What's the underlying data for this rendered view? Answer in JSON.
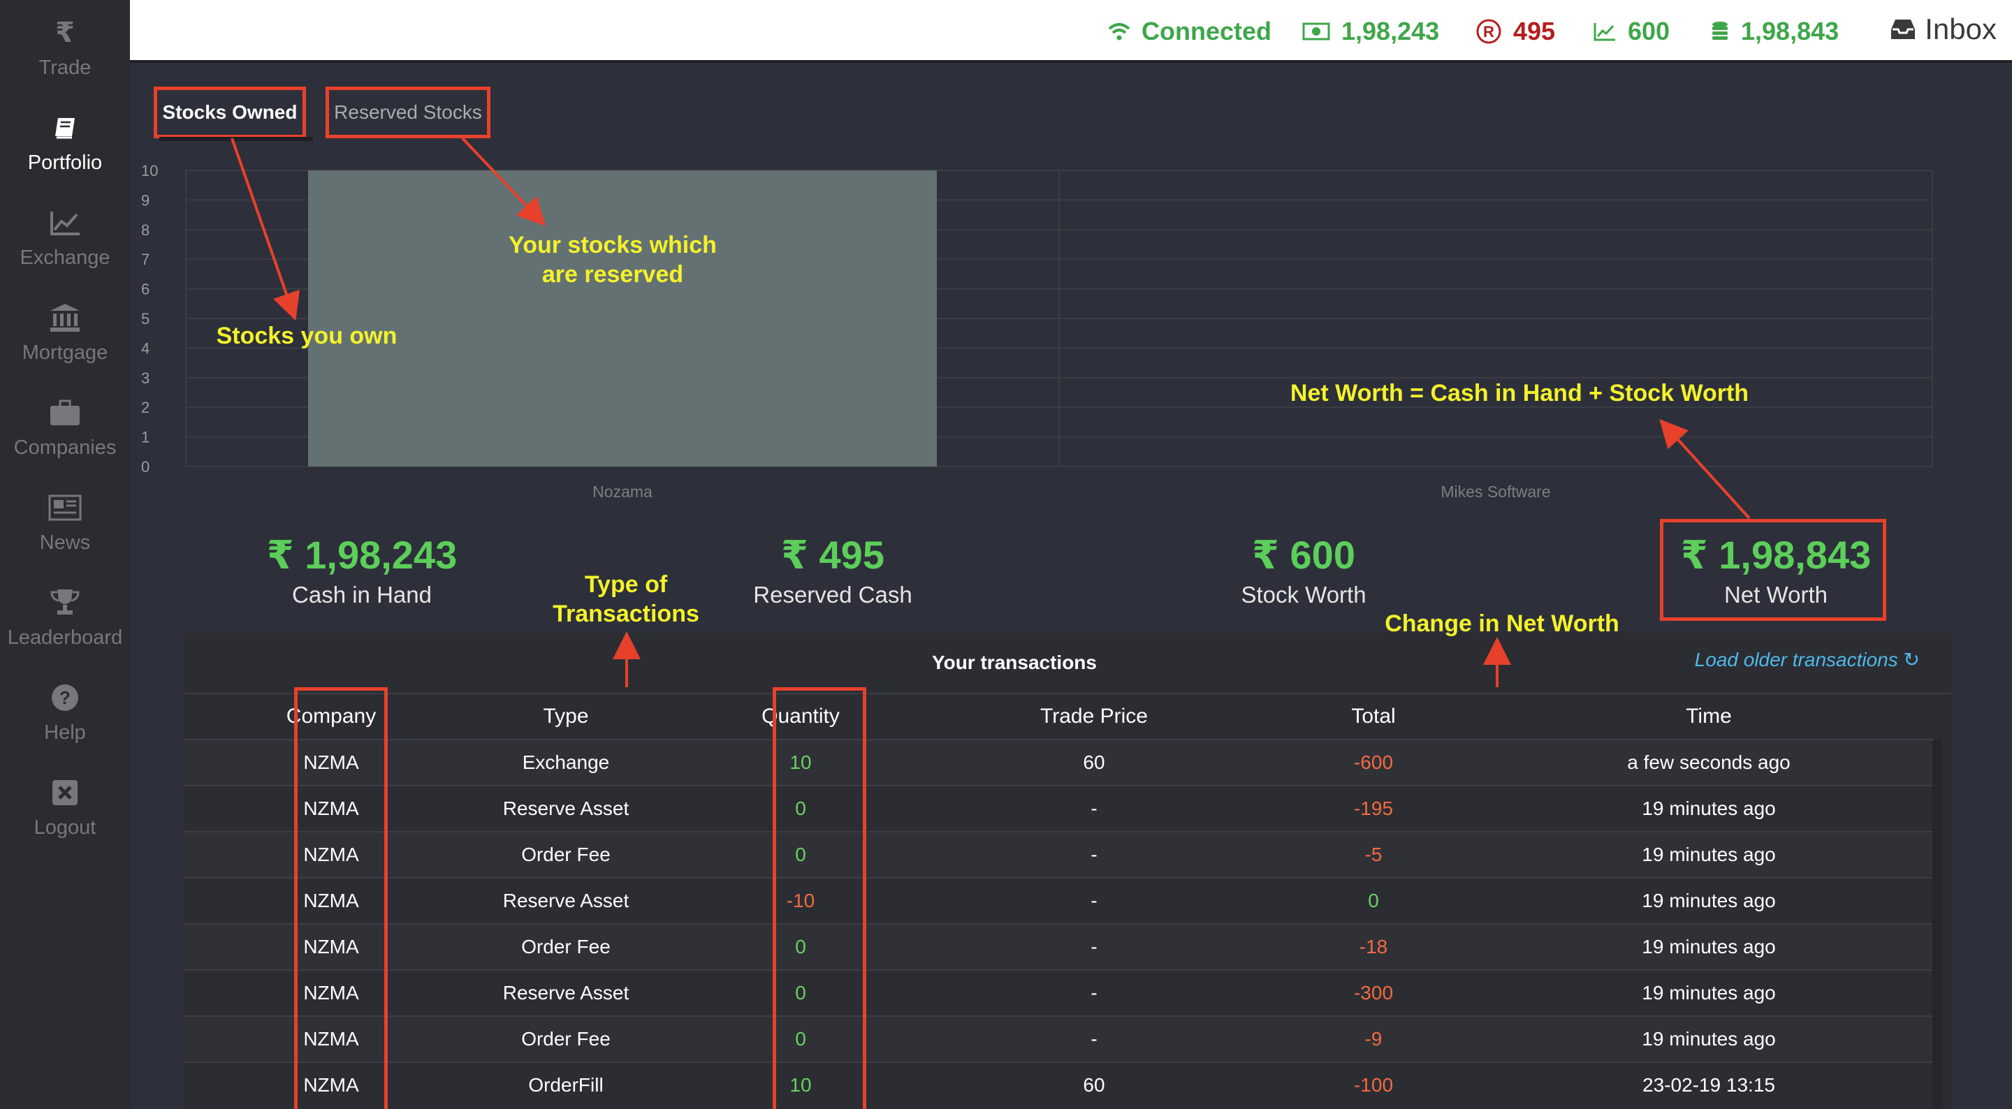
{
  "sidebar": {
    "items": [
      {
        "label": "Trade",
        "icon": "rupee-icon",
        "active": false
      },
      {
        "label": "Portfolio",
        "icon": "book-icon",
        "active": true
      },
      {
        "label": "Exchange",
        "icon": "chart-line-icon",
        "active": false
      },
      {
        "label": "Mortgage",
        "icon": "bank-icon",
        "active": false
      },
      {
        "label": "Companies",
        "icon": "briefcase-icon",
        "active": false
      },
      {
        "label": "News",
        "icon": "newspaper-icon",
        "active": false
      },
      {
        "label": "Leaderboard",
        "icon": "trophy-icon",
        "active": false
      },
      {
        "label": "Help",
        "icon": "question-icon",
        "active": false
      },
      {
        "label": "Logout",
        "icon": "close-box-icon",
        "active": false
      }
    ]
  },
  "topbar": {
    "connected": "Connected",
    "cash": "1,98,243",
    "reserved": "495",
    "stock_worth": "600",
    "net_worth": "1,98,843",
    "inbox": "Inbox"
  },
  "tabs": {
    "owned": "Stocks Owned",
    "reserved": "Reserved Stocks"
  },
  "chart_data": {
    "type": "bar",
    "categories": [
      "Nozama",
      "Mikes Software"
    ],
    "values": [
      10,
      0
    ],
    "ylim": [
      0,
      10
    ],
    "yticks": [
      "0",
      "1",
      "2",
      "3",
      "4",
      "5",
      "6",
      "7",
      "8",
      "9",
      "10"
    ],
    "bar_color": "#647173",
    "grid": true
  },
  "summary": {
    "cash": {
      "value": "₹ 1,98,243",
      "label": "Cash in Hand"
    },
    "reserved": {
      "value": "₹ 495",
      "label": "Reserved Cash"
    },
    "stock": {
      "value": "₹ 600",
      "label": "Stock Worth"
    },
    "net": {
      "value": "₹ 1,98,843",
      "label": "Net Worth"
    }
  },
  "annotations": {
    "stocks_you_own": "Stocks you own",
    "reserved_stocks_1": "Your stocks which",
    "reserved_stocks_2": "are reserved",
    "net_worth_formula": "Net Worth = Cash in Hand + Stock Worth",
    "type_1": "Type of",
    "type_2": "Transactions",
    "change_net_worth": "Change in Net Worth"
  },
  "transactions": {
    "title": "Your transactions",
    "load_older": "Load older transactions",
    "headers": [
      "Company",
      "Type",
      "Quantity",
      "Trade Price",
      "Total",
      "Time"
    ],
    "rows": [
      {
        "company": "NZMA",
        "type": "Exchange",
        "quantity": "10",
        "price": "60",
        "total": "-600",
        "time": "a few seconds ago"
      },
      {
        "company": "NZMA",
        "type": "Reserve Asset",
        "quantity": "0",
        "price": "-",
        "total": "-195",
        "time": "19 minutes ago"
      },
      {
        "company": "NZMA",
        "type": "Order Fee",
        "quantity": "0",
        "price": "-",
        "total": "-5",
        "time": "19 minutes ago"
      },
      {
        "company": "NZMA",
        "type": "Reserve Asset",
        "quantity": "-10",
        "price": "-",
        "total": "0",
        "time": "19 minutes ago"
      },
      {
        "company": "NZMA",
        "type": "Order Fee",
        "quantity": "0",
        "price": "-",
        "total": "-18",
        "time": "19 minutes ago"
      },
      {
        "company": "NZMA",
        "type": "Reserve Asset",
        "quantity": "0",
        "price": "-",
        "total": "-300",
        "time": "19 minutes ago"
      },
      {
        "company": "NZMA",
        "type": "Order Fee",
        "quantity": "0",
        "price": "-",
        "total": "-9",
        "time": "19 minutes ago"
      },
      {
        "company": "NZMA",
        "type": "OrderFill",
        "quantity": "10",
        "price": "60",
        "total": "-100",
        "time": "23-02-19 13:15"
      }
    ]
  },
  "colors": {
    "positive": "#69d160",
    "negative": "#f26a3f",
    "annotation": "#f4f22a",
    "highlight": "#e8412b",
    "accent_green": "#3fa64a",
    "accent_red": "#b41e1e"
  }
}
